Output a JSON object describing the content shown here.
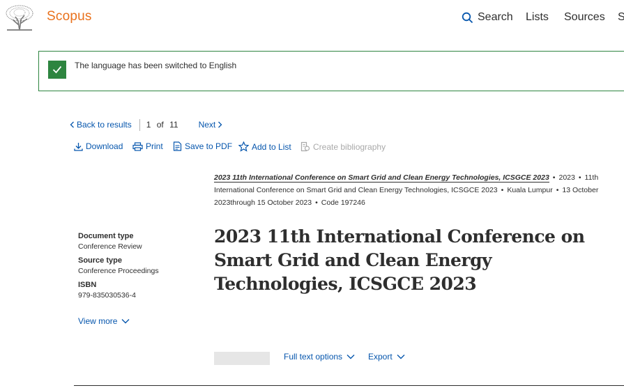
{
  "header": {
    "brand": "Scopus",
    "nav": {
      "search": "Search",
      "lists": "Lists",
      "sources": "Sources",
      "cut": "S"
    }
  },
  "alert": {
    "message": "The language has been switched to English"
  },
  "results_nav": {
    "back": "Back to results",
    "current": "1",
    "of": "of",
    "total": "11",
    "next": "Next"
  },
  "toolbar": {
    "download": "Download",
    "print": "Print",
    "save_pdf": "Save to PDF",
    "add_list": "Add to List",
    "bibliography": "Create bibliography"
  },
  "source": {
    "conference": "2023 11th International Conference on Smart Grid and Clean Energy Technologies, ICSGCE 2023",
    "year": "2023",
    "volume": "11th International Conference on Smart Grid and Clean Energy Technologies, ICSGCE 2023",
    "location": "Kuala Lumpur",
    "dates": "13 October 2023through 15 October 2023",
    "code": "Code 197246"
  },
  "meta": {
    "doc_type_label": "Document type",
    "doc_type": "Conference Review",
    "source_type_label": "Source type",
    "source_type": "Conference Proceedings",
    "isbn_label": "ISBN",
    "isbn": "979-835030536-4",
    "view_more": "View more"
  },
  "title": "2023 11th International Conference on Smart Grid and Clean Energy Technologies, ICSGCE 2023",
  "actions": {
    "full_text": "Full text options",
    "export": "Export"
  },
  "colors": {
    "brand": "#e9711c",
    "link": "#0656ad",
    "success": "#2e8540"
  }
}
